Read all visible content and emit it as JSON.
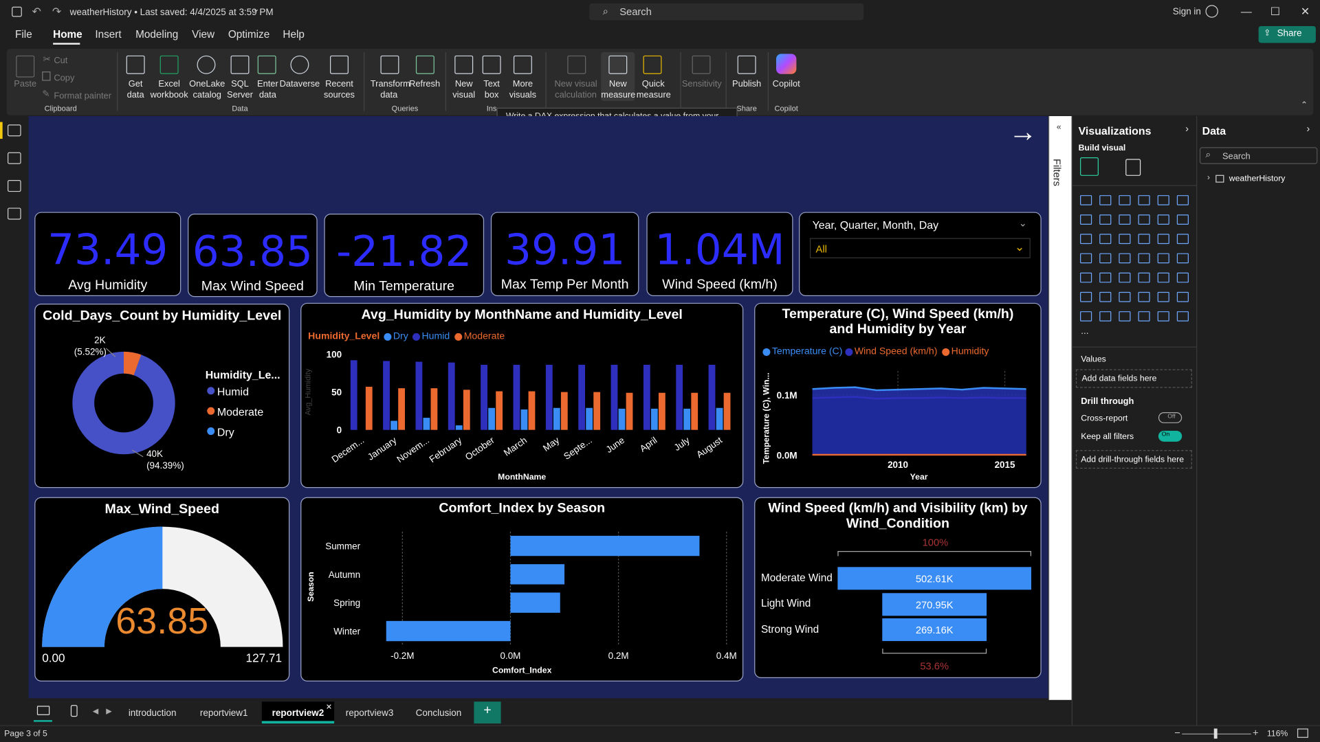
{
  "titlebar": {
    "title": "weatherHistory • Last saved: 4/4/2025 at 3:59 PM",
    "search_placeholder": "Search",
    "sign_in": "Sign in"
  },
  "menu": [
    "File",
    "Home",
    "Insert",
    "Modeling",
    "View",
    "Optimize",
    "Help"
  ],
  "share_label": "Share",
  "ribbon": {
    "clipboard": {
      "paste": "Paste",
      "cut": "Cut",
      "copy": "Copy",
      "format_painter": "Format painter",
      "group": "Clipboard"
    },
    "data": {
      "get_data": "Get data",
      "excel": "Excel workbook",
      "onelake": "OneLake catalog",
      "sql": "SQL Server",
      "enter": "Enter data",
      "dataverse": "Dataverse",
      "recent": "Recent sources",
      "group": "Data"
    },
    "queries": {
      "transform": "Transform data",
      "refresh": "Refresh",
      "group": "Queries"
    },
    "insert": {
      "new_visual": "New visual",
      "text_box": "Text box",
      "more_visuals": "More visuals",
      "group": "Ins"
    },
    "calc": {
      "new_visual_calc": "New visual calculation",
      "new_measure": "New measure",
      "quick_measure": "Quick measure"
    },
    "sensitivity": "Sensitivity",
    "share": {
      "publish": "Publish",
      "group": "Share"
    },
    "copilot": {
      "label": "Copilot",
      "group": "Copilot"
    }
  },
  "tooltip": "Write a DAX expression that calculates a value from your data.",
  "kpis": [
    {
      "value": "73.49",
      "label": "Avg Humidity"
    },
    {
      "value": "63.85",
      "label": "Max Wind Speed"
    },
    {
      "value": "-21.82",
      "label": "Min Temperature"
    },
    {
      "value": "39.91",
      "label": "Max Temp Per Month"
    },
    {
      "value": "1.04M",
      "label": "Wind Speed (km/h)"
    }
  ],
  "slicer": {
    "title": "Year, Quarter, Month, Day",
    "value": "All"
  },
  "donut": {
    "title": "Cold_Days_Count by Humidity_Level",
    "legend_title": "Humidity_Le...",
    "legend": [
      "Humid",
      "Moderate",
      "Dry"
    ],
    "label_small": "2K",
    "label_small_pct": "(5.52%)",
    "label_big": "40K",
    "label_big_pct": "(94.39%)",
    "colors": {
      "Humid": "#4651c7",
      "Moderate": "#ec6a2f",
      "Dry": "#3a8df5"
    }
  },
  "gauge": {
    "title": "Max_Wind_Speed",
    "value": "63.85",
    "min": "0.00",
    "max": "127.71"
  },
  "funnel": {
    "title": "Wind Speed (km/h) and Visibility (km) by Wind_Condition",
    "top_pct": "100%",
    "bottom_pct": "53.6%",
    "rows": [
      {
        "label": "Moderate Wind",
        "value": "502.61K"
      },
      {
        "label": "Light Wind",
        "value": "270.95K"
      },
      {
        "label": "Strong Wind",
        "value": "269.16K"
      }
    ]
  },
  "chart_data": [
    {
      "type": "bar",
      "title": "Avg_Humidity by MonthName and Humidity_Level",
      "legend_title": "Humidity_Level",
      "xlabel": "MonthName",
      "ylabel": "Avg_Humidity",
      "yticks": [
        "100",
        "50",
        "0"
      ],
      "ylim": [
        0,
        100
      ],
      "categories": [
        "Decem...",
        "January",
        "Novem...",
        "February",
        "October",
        "March",
        "May",
        "Septe...",
        "June",
        "April",
        "July",
        "August"
      ],
      "series": [
        {
          "name": "Dry",
          "color": "#3a8df5",
          "values": [
            0,
            12,
            16,
            6,
            29,
            27,
            29,
            29,
            28,
            28,
            28,
            29
          ]
        },
        {
          "name": "Humid",
          "color": "#2f2fbe",
          "values": [
            92,
            91,
            90,
            89,
            86,
            86,
            86,
            86,
            86,
            86,
            86,
            86
          ]
        },
        {
          "name": "Moderate",
          "color": "#ec6a2f",
          "values": [
            57,
            55,
            55,
            53,
            51,
            51,
            50,
            50,
            49,
            49,
            49,
            49
          ]
        }
      ]
    },
    {
      "type": "area",
      "title": "Temperature (C), Wind Speed (km/h) and Humidity by Year",
      "xlabel": "Year",
      "ylabel": "Temperature (C), Win...",
      "xticks": [
        "2010",
        "2015"
      ],
      "yticks": [
        "0.1M",
        "0.0M"
      ],
      "x": [
        2006,
        2007,
        2008,
        2009,
        2010,
        2011,
        2012,
        2013,
        2014,
        2015,
        2016
      ],
      "series": [
        {
          "name": "Temperature (C)",
          "color": "#3a8df5",
          "values": [
            0.11,
            0.112,
            0.113,
            0.108,
            0.109,
            0.11,
            0.111,
            0.109,
            0.112,
            0.111,
            0.11
          ]
        },
        {
          "name": "Wind Speed (km/h)",
          "color": "#2f2fbe",
          "values": [
            0.095,
            0.096,
            0.097,
            0.094,
            0.095,
            0.095,
            0.096,
            0.095,
            0.096,
            0.095,
            0.095
          ]
        },
        {
          "name": "Humidity",
          "color": "#ec6a2f",
          "values": [
            0.0006,
            0.0006,
            0.0006,
            0.0006,
            0.0006,
            0.0006,
            0.0006,
            0.0006,
            0.0006,
            0.0006,
            0.0006
          ]
        }
      ]
    },
    {
      "type": "bar",
      "orientation": "horizontal",
      "title": "Comfort_Index by Season",
      "xlabel": "Comfort_Index",
      "ylabel": "Season",
      "xticks": [
        "-0.2M",
        "0.0M",
        "0.2M",
        "0.4M"
      ],
      "xlim": [
        -0.2,
        0.4
      ],
      "categories": [
        "Summer",
        "Autumn",
        "Spring",
        "Winter"
      ],
      "values": [
        0.35,
        0.1,
        0.092,
        -0.23
      ]
    }
  ],
  "viz_pane": {
    "title": "Visualizations",
    "build": "Build visual",
    "values": "Values",
    "add_fields": "Add data fields here",
    "drill": "Drill through",
    "cross_report": "Cross-report",
    "cross_state": "Off",
    "keep_filters": "Keep all filters",
    "keep_state": "On",
    "add_drill": "Add drill-through fields here",
    "more": "..."
  },
  "data_pane": {
    "title": "Data",
    "search": "Search",
    "table": "weatherHistory"
  },
  "filters_label": "Filters",
  "pages": [
    "introduction",
    "reportview1",
    "reportview2",
    "reportview3",
    "Conclusion"
  ],
  "active_page": "reportview2",
  "status": {
    "page": "Page 3 of 5",
    "zoom": "116%"
  }
}
